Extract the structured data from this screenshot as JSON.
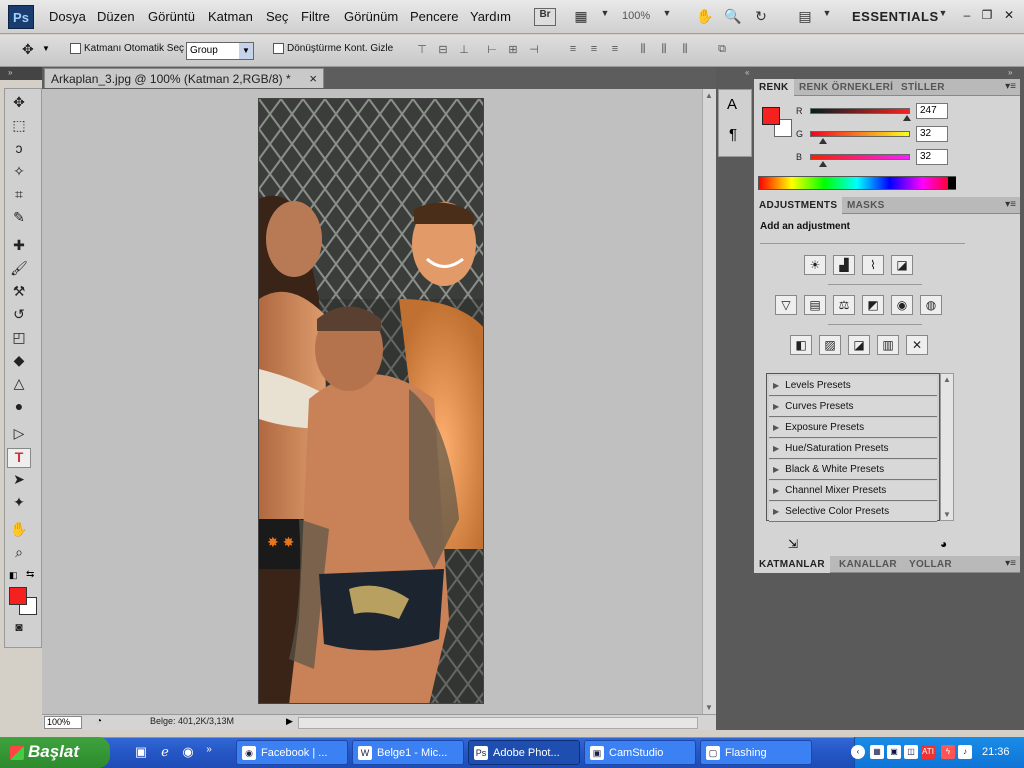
{
  "menubar": {
    "logo": "Ps",
    "items": [
      "Dosya",
      "Düzen",
      "Görüntü",
      "Katman",
      "Seç",
      "Filtre",
      "Görünüm",
      "Pencere",
      "Yardım"
    ],
    "bridge": "Br",
    "zoom": "100%",
    "workspace": "ESSENTIALS"
  },
  "options": {
    "auto_select_label": "Katmanı Otomatik Seç",
    "group_value": "Group",
    "transform_label": "Dönüştürme Kont. Gizle"
  },
  "document": {
    "tab_title": "Arkaplan_3.jpg @ 100% (Katman 2,RGB/8) *",
    "close": "×"
  },
  "status": {
    "zoom": "100%",
    "doc_size": "Belge: 401,2K/3,13M"
  },
  "color_panel": {
    "tabs": [
      "RENK",
      "RENK ÖRNEKLERİ",
      "STİLLER"
    ],
    "channels": [
      {
        "label": "R",
        "value": "247",
        "level": 0.969,
        "grad": "linear-gradient(to right,#002020,#ff2020)"
      },
      {
        "label": "G",
        "value": "32",
        "level": 0.125,
        "grad": "linear-gradient(to right,#f70020,#f7ff20)"
      },
      {
        "label": "B",
        "value": "32",
        "level": 0.125,
        "grad": "linear-gradient(to right,#f72000,#f720ff)"
      }
    ],
    "fg_color": "#f72020",
    "bg_color": "#ffffff"
  },
  "adjustments_panel": {
    "tabs": [
      "ADJUSTMENTS",
      "MASKS"
    ],
    "heading": "Add an adjustment",
    "presets": [
      "Levels Presets",
      "Curves Presets",
      "Exposure Presets",
      "Hue/Saturation Presets",
      "Black & White Presets",
      "Channel Mixer Presets",
      "Selective Color Presets"
    ]
  },
  "layers_panel": {
    "tabs": [
      "KATMANLAR",
      "KANALLAR",
      "YOLLAR"
    ]
  },
  "taskbar": {
    "start": "Başlat",
    "tasks": [
      {
        "label": "Facebook | ...",
        "icon": "firefox-icon"
      },
      {
        "label": "Belge1 - Mic...",
        "icon": "word-icon"
      },
      {
        "label": "Adobe Phot...",
        "icon": "photoshop-icon",
        "active": true
      },
      {
        "label": "CamStudio",
        "icon": "camstudio-icon"
      },
      {
        "label": "Flashing",
        "icon": "window-icon"
      }
    ],
    "tray_badge": "ATI",
    "clock": "21:36"
  }
}
